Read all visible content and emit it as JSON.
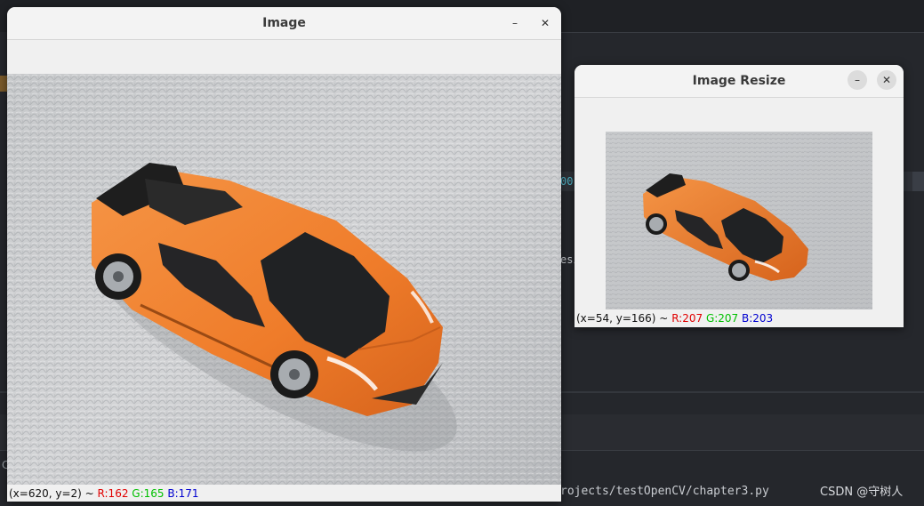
{
  "ide": {
    "code_fragment_1": "00",
    "code_fragment_2": "esi",
    "file_path": "rojects/testOpenCV/chapter3.py",
    "left_char": "C",
    "watermark": "CSDN @守树人"
  },
  "window_image": {
    "title": "Image",
    "minimize_label": "–",
    "close_label": "✕",
    "status": {
      "coords": "(x=620, y=2) ~",
      "r": "R:162",
      "g": "G:165",
      "b": "B:171"
    }
  },
  "window_resize": {
    "title": "Image Resize",
    "minimize_label": "–",
    "close_label": "✕",
    "status": {
      "coords": "(x=54, y=166) ~",
      "r": "R:207",
      "g": "G:207",
      "b": "B:203"
    }
  },
  "colors": {
    "car_body": "#f07f2c",
    "car_shade": "#c95f1a",
    "window_glass": "#222222",
    "carpet": "#c9cbcd",
    "status_r": "#e00000",
    "status_g": "#00c000",
    "status_b": "#0000d0"
  }
}
